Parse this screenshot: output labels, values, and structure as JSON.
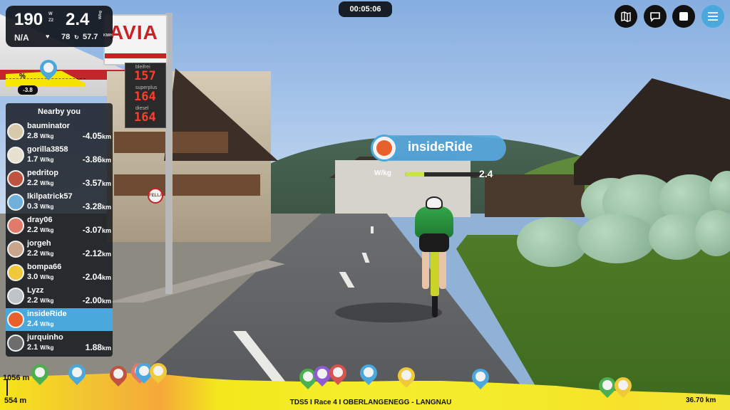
{
  "stats": {
    "power": "190",
    "power_unit": "W",
    "zone": "Z2",
    "wkg": "2.4",
    "wkg_unit": "W/kg",
    "heart_rate": "N/A",
    "cadence": "78",
    "speed": "57.7",
    "speed_unit": "KM/H"
  },
  "timer": "00:05:06",
  "controls": [
    {
      "name": "map-button",
      "icon": "map-icon"
    },
    {
      "name": "chat-button",
      "icon": "chat-icon"
    },
    {
      "name": "stop-button",
      "icon": "stop-icon"
    },
    {
      "name": "menu-button",
      "icon": "hamburger-icon"
    }
  ],
  "grade": {
    "label": "%",
    "value": "-3.8"
  },
  "scene": {
    "sign_brand": "AVIA",
    "fuel_prices": [
      {
        "label": "bleifrei",
        "value": "157"
      },
      {
        "label": "superplus",
        "value": "164"
      },
      {
        "label": "diesel",
        "value": "164"
      }
    ],
    "shop_sign": "FELLA"
  },
  "nearby": {
    "title": "Nearby you",
    "riders": [
      {
        "name": "bauminator",
        "wkg": "2.8",
        "unit": "W/kg",
        "gap": "-4.05",
        "gap_unit": "km",
        "color": "#d8c9a8"
      },
      {
        "name": "gorilla3858",
        "wkg": "1.7",
        "unit": "W/kg",
        "gap": "-3.86",
        "gap_unit": "km",
        "color": "#e9e1cf"
      },
      {
        "name": "pedritop",
        "wkg": "2.2",
        "unit": "W/kg",
        "gap": "-3.57",
        "gap_unit": "km",
        "color": "#c0533f"
      },
      {
        "name": "lkilpatrick57",
        "wkg": "0.3",
        "unit": "W/kg",
        "gap": "-3.28",
        "gap_unit": "km",
        "color": "#6fb0dc"
      },
      {
        "name": "dray06",
        "wkg": "2.2",
        "unit": "W/kg",
        "gap": "-3.07",
        "gap_unit": "km",
        "color": "#e07a6a"
      },
      {
        "name": "jorgeh",
        "wkg": "2.2",
        "unit": "W/kg",
        "gap": "-2.12",
        "gap_unit": "km",
        "color": "#caa58a"
      },
      {
        "name": "bompa66",
        "wkg": "3.0",
        "unit": "W/kg",
        "gap": "-2.04",
        "gap_unit": "km",
        "color": "#f0c93a"
      },
      {
        "name": "Lyzz",
        "wkg": "2.2",
        "unit": "W/kg",
        "gap": "-2.00",
        "gap_unit": "km",
        "color": "#bfc4c9"
      },
      {
        "name": "insideRide",
        "wkg": "2.4",
        "unit": "W/kg",
        "gap": "",
        "gap_unit": "",
        "color": "#e8612c",
        "self": true
      },
      {
        "name": "jurquinho",
        "wkg": "2.1",
        "unit": "W/kg",
        "gap": "1.88",
        "gap_unit": "km",
        "color": "#6d6d6d"
      }
    ]
  },
  "nametag": {
    "name": "insideRide",
    "metric_label": "W/kg",
    "metric_value": "2.4",
    "metric_fraction": 0.24
  },
  "profile": {
    "max_elevation": "1056 m",
    "min_elevation": "554 m",
    "route": "TDS5 I Race 4 I OBERLANGENEGG - LANGNAU",
    "total_distance": "36.70 km",
    "marker_colors": [
      "#4caf50",
      "#4aa8dc",
      "#c0533f",
      "#e07a6a",
      "#4aa8dc",
      "#f0c93a",
      "#4caf50",
      "#8e5bd1",
      "#d9534f",
      "#4aa8dc",
      "#f0c93a",
      "#4aa8dc",
      "#4caf50",
      "#f0c93a"
    ]
  }
}
